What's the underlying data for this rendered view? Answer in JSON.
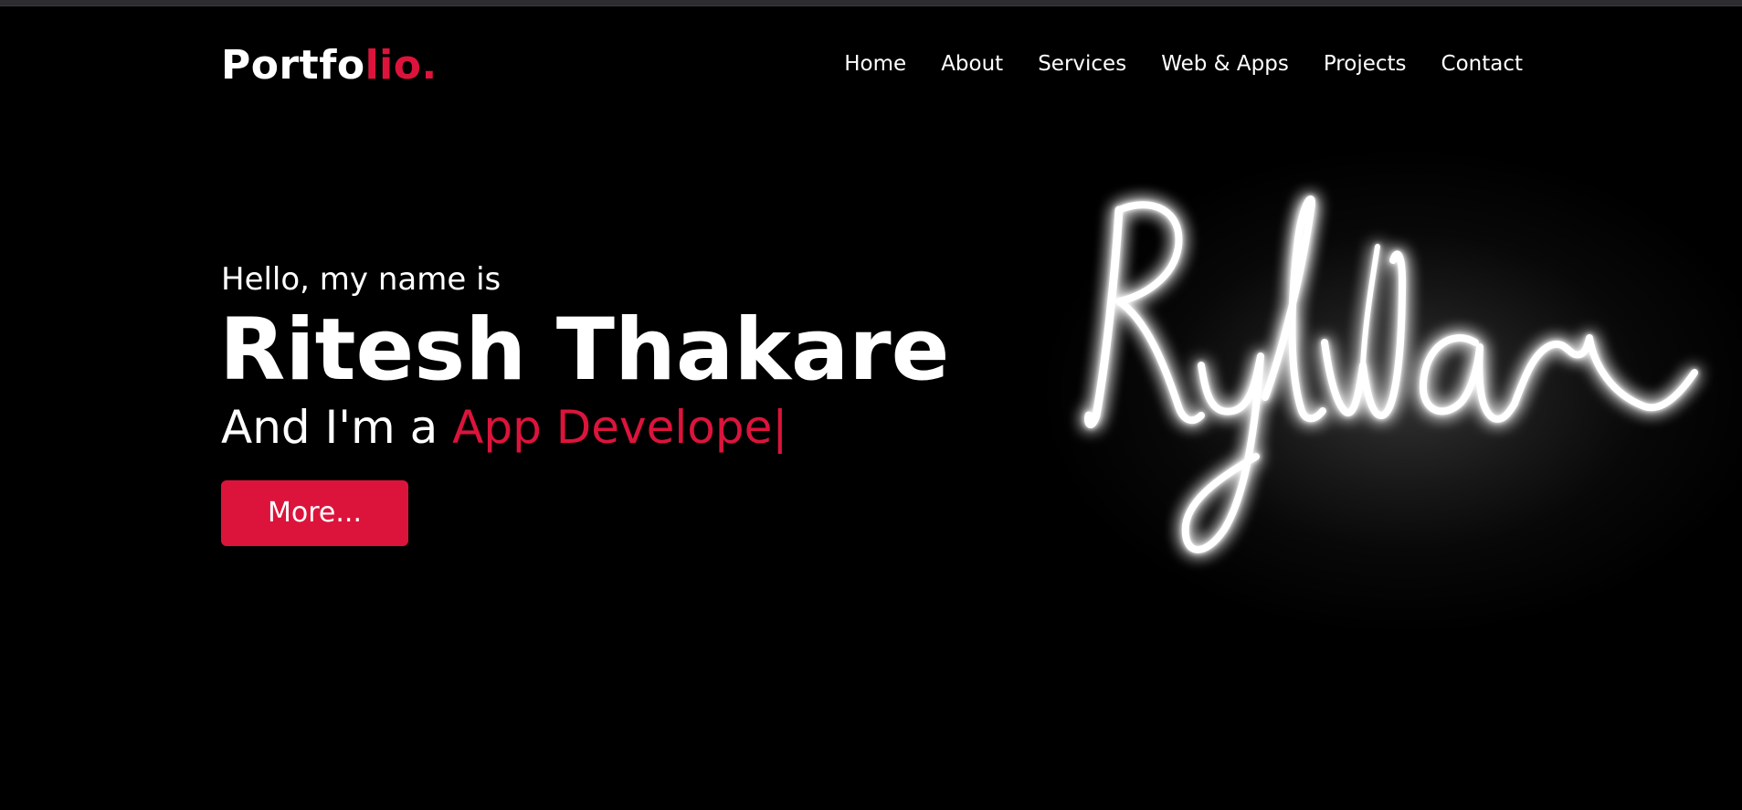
{
  "window": {
    "top_border_color": "#2c2c31"
  },
  "colors": {
    "background": "#000000",
    "accent": "#dc143c",
    "text": "#ffffff"
  },
  "header": {
    "logo_main": "Portfo",
    "logo_accent": "lio.",
    "nav": [
      {
        "label": "Home"
      },
      {
        "label": "About"
      },
      {
        "label": "Services"
      },
      {
        "label": "Web & Apps"
      },
      {
        "label": "Projects"
      },
      {
        "label": "Contact"
      }
    ]
  },
  "hero": {
    "greeting": "Hello, my name is",
    "name": "Ritesh Thakare",
    "role_prefix": "And I'm a ",
    "role_typed": "App Develope",
    "cursor": "|",
    "button_label": "More..."
  },
  "signature": {
    "text": "Rylwar",
    "style": "glowing handwritten white signature"
  }
}
